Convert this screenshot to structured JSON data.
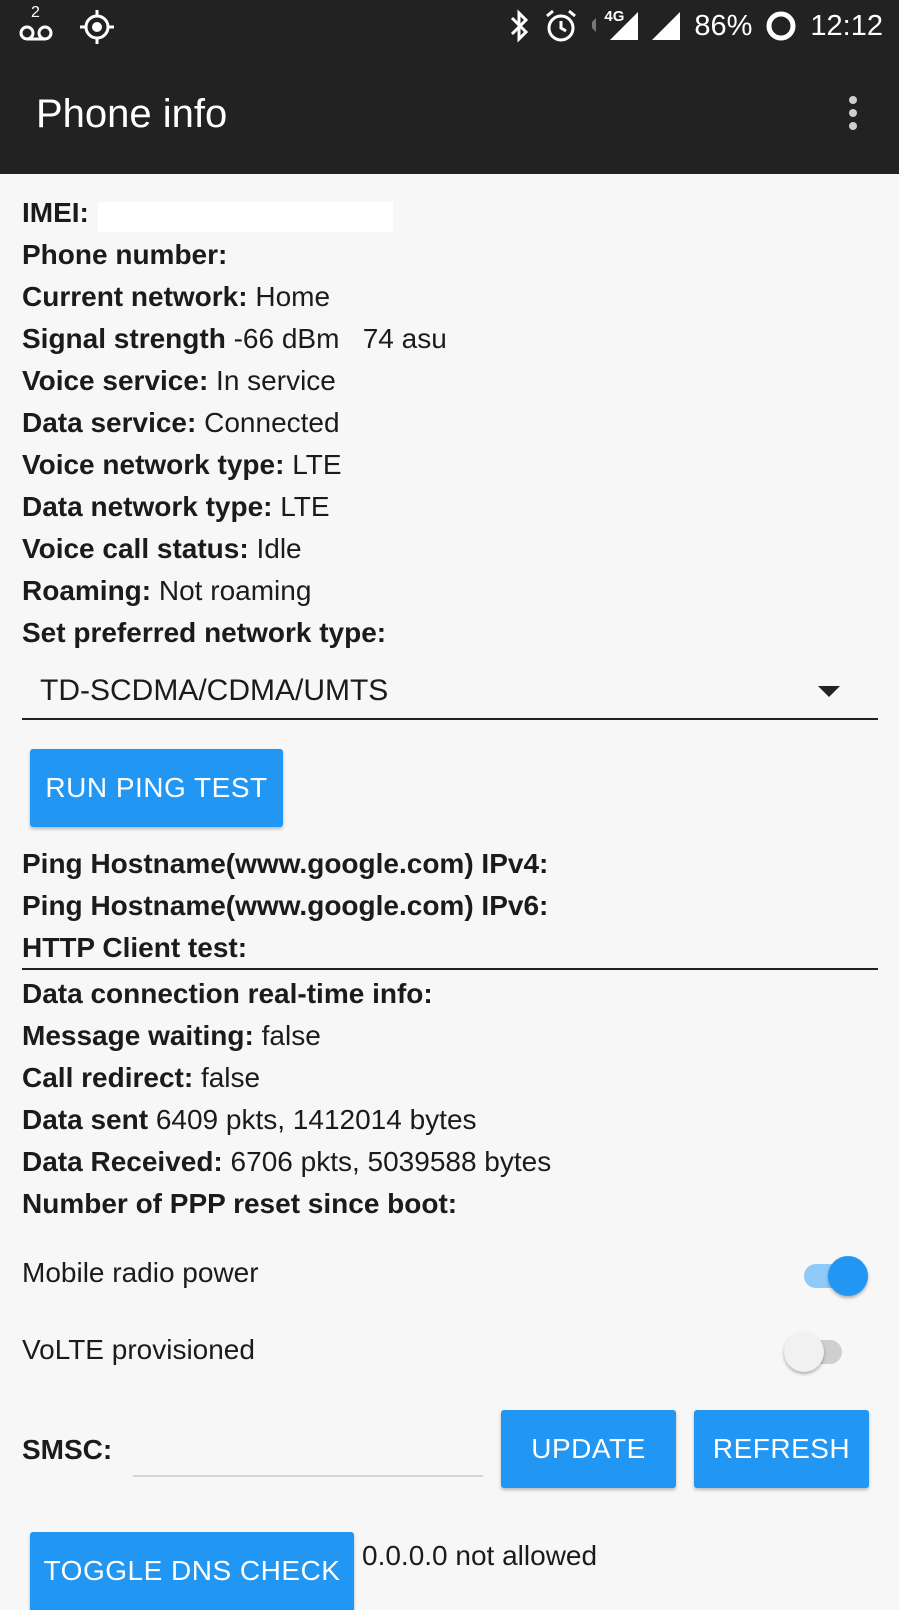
{
  "status_bar": {
    "time": "12:12",
    "battery": "86%",
    "network": "4G",
    "notification_count": "2",
    "icons": [
      "voicemail-icon",
      "target-icon",
      "bluetooth-icon",
      "alarm-icon",
      "signal-4g-icon",
      "signal-icon",
      "battery-ring-icon"
    ]
  },
  "app_bar": {
    "title": "Phone info"
  },
  "info": {
    "imei_label": "IMEI:",
    "phone_number_label": "Phone number:",
    "current_network_label": "Current network:",
    "current_network_value": "Home",
    "signal_strength_label": "Signal strength",
    "signal_strength_value": "-66 dBm   74 asu",
    "voice_service_label": "Voice service:",
    "voice_service_value": "In service",
    "data_service_label": "Data service:",
    "data_service_value": "Connected",
    "voice_network_type_label": "Voice network type:",
    "voice_network_type_value": "LTE",
    "data_network_type_label": "Data network type:",
    "data_network_type_value": "LTE",
    "voice_call_status_label": "Voice call status:",
    "voice_call_status_value": "Idle",
    "roaming_label": "Roaming:",
    "roaming_value": "Not roaming",
    "preferred_network_label": "Set preferred network type:",
    "preferred_network_value": "TD-SCDMA/CDMA/UMTS"
  },
  "ping": {
    "button_label": "RUN PING TEST",
    "ipv4_label": "Ping Hostname(www.google.com) IPv4:",
    "ipv6_label": "Ping Hostname(www.google.com) IPv6:",
    "http_label": "HTTP Client test:"
  },
  "data_info": {
    "realtime_label": "Data connection real-time info:",
    "message_waiting_label": "Message waiting:",
    "message_waiting_value": "false",
    "call_redirect_label": "Call redirect:",
    "call_redirect_value": "false",
    "data_sent_label": "Data sent",
    "data_sent_value": "6409 pkts, 1412014 bytes",
    "data_received_label": "Data Received:",
    "data_received_value": "6706 pkts, 5039588 bytes",
    "ppp_reset_label": "Number of PPP reset since boot:"
  },
  "toggles": {
    "mobile_radio_label": "Mobile radio power",
    "mobile_radio_on": true,
    "volte_label": "VoLTE provisioned",
    "volte_on": false
  },
  "smsc": {
    "label": "SMSC:",
    "value": "",
    "update_label": "UPDATE",
    "refresh_label": "REFRESH"
  },
  "dns": {
    "button_label": "TOGGLE DNS CHECK",
    "status": "0.0.0.0 not allowed"
  },
  "colors": {
    "accent": "#2196f3",
    "bar": "#222222",
    "background": "#f7f7f7"
  }
}
